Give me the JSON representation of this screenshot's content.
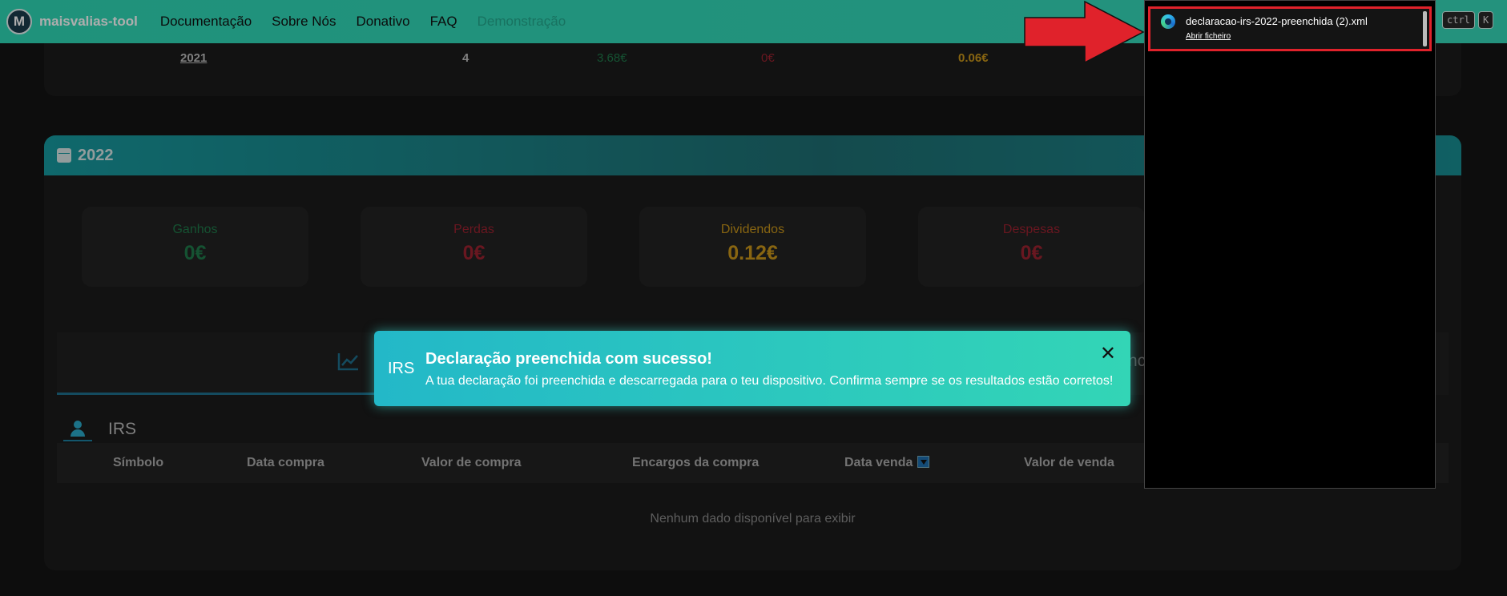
{
  "navbar": {
    "brand": "maisvalias-tool",
    "logo_letter": "M",
    "links": [
      "Documentação",
      "Sobre Nós",
      "Donativo",
      "FAQ",
      "Demonstração"
    ],
    "kbd": [
      "ctrl",
      "K"
    ]
  },
  "top_row": {
    "year": "2021",
    "count": "4",
    "gains": "3.68€",
    "losses": "0€",
    "dividends": "0.06€"
  },
  "year_card": {
    "year": "2022",
    "stats": [
      {
        "label": "Ganhos",
        "value": "0€",
        "color": "#1f7a4a"
      },
      {
        "label": "Perdas",
        "value": "0€",
        "color": "#9b2230"
      },
      {
        "label": "Dividendos",
        "value": "0.12€",
        "color": "#c9961a"
      },
      {
        "label": "Despesas",
        "value": "0€",
        "color": "#9b2230"
      }
    ],
    "tab_partial_right": "nc",
    "section_title": "IRS",
    "table_headers": [
      "Símbolo",
      "Data compra",
      "Valor de compra",
      "Encargos da compra",
      "Data venda",
      "Valor de venda"
    ],
    "empty_message": "Nenhum dado disponível para exibir"
  },
  "toast": {
    "tag": "IRS",
    "title": "Declaração preenchida com sucesso!",
    "message": "A tua declaração foi preenchida e descarregada para o teu dispositivo. Confirma sempre se os resultados estão corretos!",
    "close": "✕"
  },
  "downloads": {
    "file_name": "declaracao-irs-2022-preenchida (2).xml",
    "open_label": "Abrir ficheiro"
  },
  "colors": {
    "navbar": "#2fd8b6",
    "annotation_red": "#e0222b",
    "gain": "#1f7a4a",
    "loss": "#9b2230",
    "dividend": "#c9961a"
  }
}
